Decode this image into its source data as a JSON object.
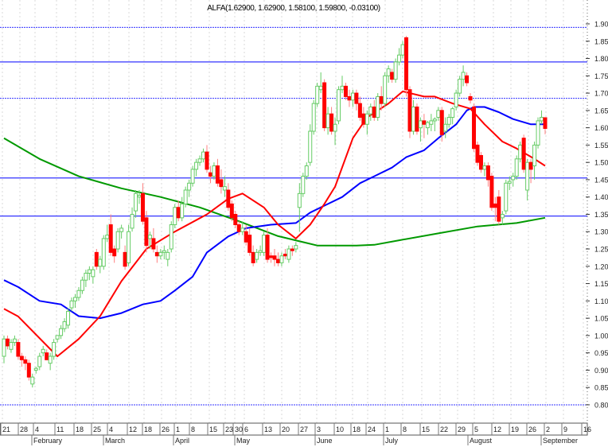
{
  "chart_data": {
    "type": "candlestick",
    "title": "ALFA(1.62900, 1.62900, 1.58100, 1.59800, -0.03100)",
    "ylim": [
      0.78,
      1.92
    ],
    "yticks": [
      "0.80",
      "0.85",
      "0.90",
      "0.95",
      "1.00",
      "1.05",
      "1.10",
      "1.15",
      "1.20",
      "1.25",
      "1.30",
      "1.35",
      "1.40",
      "1.45",
      "1.50",
      "1.55",
      "1.60",
      "1.65",
      "1.70",
      "1.75",
      "1.80",
      "1.85",
      "1.90"
    ],
    "xtick_labels": [
      "21",
      "28",
      "4",
      "11",
      "18",
      "25",
      "4",
      "12",
      "18",
      "26",
      "1",
      "8",
      "15",
      "23",
      "30",
      "6",
      "13",
      "20",
      "27",
      "3",
      "10",
      "18",
      "24",
      "1",
      "8",
      "15",
      "22",
      "29",
      "5",
      "12",
      "19",
      "26",
      "2",
      "9",
      "16"
    ],
    "months": [
      "February",
      "March",
      "April",
      "May",
      "June",
      "July",
      "August",
      "September"
    ],
    "grid": true,
    "colors": {
      "up": "#66cc66",
      "up_filled": "#009900",
      "down": "#ff0000",
      "level": "#3333ff",
      "ma_fast": "#ff0000",
      "ma_mid": "#0000ff",
      "ma_slow": "#009900"
    },
    "levels": [
      {
        "value": 1.89,
        "style": "dotted"
      },
      {
        "value": 1.79,
        "style": "solid"
      },
      {
        "value": 1.685,
        "style": "dotted"
      },
      {
        "value": 1.455,
        "style": "solid"
      },
      {
        "value": 1.345,
        "style": "solid"
      },
      {
        "value": 0.8,
        "style": "dotted"
      }
    ],
    "ohlc": [
      [
        0.94,
        1.0,
        0.92,
        0.99
      ],
      [
        0.99,
        1.0,
        0.96,
        0.97
      ],
      [
        0.96,
        0.99,
        0.95,
        0.98
      ],
      [
        0.98,
        1.0,
        0.97,
        0.99
      ],
      [
        0.98,
        0.99,
        0.93,
        0.94
      ],
      [
        0.94,
        0.95,
        0.91,
        0.93
      ],
      [
        0.93,
        0.94,
        0.9,
        0.92
      ],
      [
        0.92,
        0.93,
        0.87,
        0.88
      ],
      [
        0.86,
        0.89,
        0.85,
        0.88
      ],
      [
        0.9,
        0.91,
        0.89,
        0.905
      ],
      [
        0.91,
        0.95,
        0.9,
        0.94
      ],
      [
        0.95,
        0.97,
        0.94,
        0.96
      ],
      [
        0.95,
        0.96,
        0.93,
        0.93
      ],
      [
        0.92,
        0.95,
        0.9,
        0.94
      ],
      [
        0.94,
        0.99,
        0.93,
        0.98
      ],
      [
        0.99,
        1.0,
        0.98,
        1.0
      ],
      [
        1.0,
        1.03,
        0.99,
        1.02
      ],
      [
        1.02,
        1.05,
        1.01,
        1.04
      ],
      [
        1.03,
        1.08,
        1.02,
        1.07
      ],
      [
        1.08,
        1.11,
        1.07,
        1.1
      ],
      [
        1.1,
        1.12,
        1.08,
        1.11
      ],
      [
        1.11,
        1.14,
        1.1,
        1.13
      ],
      [
        1.13,
        1.17,
        1.12,
        1.16
      ],
      [
        1.16,
        1.19,
        1.14,
        1.18
      ],
      [
        1.18,
        1.2,
        1.16,
        1.19
      ],
      [
        1.17,
        1.2,
        1.15,
        1.19
      ],
      [
        1.24,
        1.25,
        1.19,
        1.2
      ],
      [
        1.2,
        1.23,
        1.18,
        1.22
      ],
      [
        1.2,
        1.29,
        1.19,
        1.28
      ],
      [
        1.28,
        1.32,
        1.27,
        1.29
      ],
      [
        1.32,
        1.35,
        1.23,
        1.24
      ],
      [
        1.25,
        1.26,
        1.21,
        1.23
      ],
      [
        1.25,
        1.31,
        1.24,
        1.3
      ],
      [
        1.3,
        1.32,
        1.28,
        1.31
      ],
      [
        1.24,
        1.26,
        1.19,
        1.2
      ],
      [
        1.21,
        1.32,
        1.2,
        1.3
      ],
      [
        1.31,
        1.37,
        1.3,
        1.35
      ],
      [
        1.36,
        1.42,
        1.34,
        1.41
      ],
      [
        1.4,
        1.42,
        1.38,
        1.405
      ],
      [
        1.41,
        1.44,
        1.32,
        1.33
      ],
      [
        1.34,
        1.36,
        1.24,
        1.26
      ],
      [
        1.28,
        1.3,
        1.25,
        1.29
      ],
      [
        1.28,
        1.31,
        1.24,
        1.25
      ],
      [
        1.24,
        1.26,
        1.21,
        1.23
      ],
      [
        1.23,
        1.25,
        1.22,
        1.24
      ],
      [
        1.24,
        1.26,
        1.22,
        1.245
      ],
      [
        1.22,
        1.25,
        1.2,
        1.24
      ],
      [
        1.25,
        1.33,
        1.24,
        1.32
      ],
      [
        1.32,
        1.38,
        1.31,
        1.37
      ],
      [
        1.37,
        1.39,
        1.33,
        1.34
      ],
      [
        1.34,
        1.4,
        1.33,
        1.38
      ],
      [
        1.38,
        1.43,
        1.37,
        1.42
      ],
      [
        1.42,
        1.45,
        1.4,
        1.44
      ],
      [
        1.44,
        1.49,
        1.43,
        1.48
      ],
      [
        1.48,
        1.51,
        1.46,
        1.5
      ],
      [
        1.5,
        1.52,
        1.49,
        1.51
      ],
      [
        1.51,
        1.54,
        1.5,
        1.53
      ],
      [
        1.53,
        1.55,
        1.47,
        1.48
      ],
      [
        1.47,
        1.49,
        1.44,
        1.46
      ],
      [
        1.46,
        1.5,
        1.45,
        1.49
      ],
      [
        1.49,
        1.51,
        1.43,
        1.44
      ],
      [
        1.45,
        1.48,
        1.41,
        1.43
      ],
      [
        1.42,
        1.46,
        1.4,
        1.43
      ],
      [
        1.42,
        1.44,
        1.36,
        1.37
      ],
      [
        1.38,
        1.39,
        1.33,
        1.34
      ],
      [
        1.35,
        1.36,
        1.31,
        1.32
      ],
      [
        1.32,
        1.33,
        1.29,
        1.3
      ],
      [
        1.3,
        1.33,
        1.29,
        1.31
      ],
      [
        1.3,
        1.32,
        1.26,
        1.27
      ],
      [
        1.29,
        1.31,
        1.23,
        1.24
      ],
      [
        1.24,
        1.26,
        1.2,
        1.21
      ],
      [
        1.22,
        1.25,
        1.21,
        1.24
      ],
      [
        1.24,
        1.26,
        1.23,
        1.245
      ],
      [
        1.24,
        1.3,
        1.23,
        1.29
      ],
      [
        1.29,
        1.31,
        1.21,
        1.22
      ],
      [
        1.23,
        1.24,
        1.21,
        1.225
      ],
      [
        1.23,
        1.25,
        1.2,
        1.22
      ],
      [
        1.22,
        1.24,
        1.2,
        1.21
      ],
      [
        1.21,
        1.24,
        1.2,
        1.23
      ],
      [
        1.235,
        1.25,
        1.22,
        1.23
      ],
      [
        1.22,
        1.26,
        1.21,
        1.25
      ],
      [
        1.25,
        1.26,
        1.23,
        1.245
      ],
      [
        1.25,
        1.27,
        1.24,
        1.26
      ],
      [
        1.37,
        1.44,
        1.3,
        1.41
      ],
      [
        1.41,
        1.47,
        1.4,
        1.46
      ],
      [
        1.46,
        1.5,
        1.45,
        1.49
      ],
      [
        1.5,
        1.61,
        1.49,
        1.59
      ],
      [
        1.59,
        1.68,
        1.58,
        1.67
      ],
      [
        1.67,
        1.73,
        1.66,
        1.72
      ],
      [
        1.71,
        1.76,
        1.7,
        1.72
      ],
      [
        1.73,
        1.74,
        1.59,
        1.6
      ],
      [
        1.6,
        1.66,
        1.58,
        1.64
      ],
      [
        1.64,
        1.66,
        1.58,
        1.59
      ],
      [
        1.59,
        1.63,
        1.55,
        1.61
      ],
      [
        1.62,
        1.72,
        1.61,
        1.71
      ],
      [
        1.71,
        1.75,
        1.7,
        1.72
      ],
      [
        1.72,
        1.73,
        1.68,
        1.69
      ],
      [
        1.69,
        1.71,
        1.66,
        1.68
      ],
      [
        1.68,
        1.71,
        1.66,
        1.7
      ],
      [
        1.7,
        1.71,
        1.65,
        1.67
      ],
      [
        1.67,
        1.69,
        1.62,
        1.63
      ],
      [
        1.64,
        1.66,
        1.6,
        1.61
      ],
      [
        1.61,
        1.65,
        1.58,
        1.64
      ],
      [
        1.64,
        1.67,
        1.62,
        1.66
      ],
      [
        1.66,
        1.68,
        1.62,
        1.63
      ],
      [
        1.63,
        1.7,
        1.62,
        1.69
      ],
      [
        1.69,
        1.72,
        1.65,
        1.67
      ],
      [
        1.67,
        1.76,
        1.66,
        1.75
      ],
      [
        1.75,
        1.78,
        1.73,
        1.77
      ],
      [
        1.76,
        1.77,
        1.73,
        1.74
      ],
      [
        1.74,
        1.8,
        1.73,
        1.79
      ],
      [
        1.79,
        1.83,
        1.78,
        1.81
      ],
      [
        1.81,
        1.85,
        1.8,
        1.84
      ],
      [
        1.86,
        1.865,
        1.69,
        1.71
      ],
      [
        1.71,
        1.72,
        1.57,
        1.59
      ],
      [
        1.59,
        1.68,
        1.58,
        1.66
      ],
      [
        1.66,
        1.67,
        1.58,
        1.59
      ],
      [
        1.6,
        1.63,
        1.56,
        1.62
      ],
      [
        1.62,
        1.64,
        1.57,
        1.61
      ],
      [
        1.6,
        1.62,
        1.58,
        1.615
      ],
      [
        1.61,
        1.64,
        1.59,
        1.62
      ],
      [
        1.62,
        1.63,
        1.59,
        1.625
      ],
      [
        1.63,
        1.66,
        1.62,
        1.65
      ],
      [
        1.65,
        1.66,
        1.56,
        1.58
      ],
      [
        1.59,
        1.63,
        1.57,
        1.61
      ],
      [
        1.61,
        1.64,
        1.6,
        1.63
      ],
      [
        1.63,
        1.66,
        1.61,
        1.655
      ],
      [
        1.66,
        1.71,
        1.65,
        1.7
      ],
      [
        1.7,
        1.75,
        1.69,
        1.74
      ],
      [
        1.74,
        1.78,
        1.72,
        1.76
      ],
      [
        1.75,
        1.76,
        1.72,
        1.73
      ],
      [
        1.69,
        1.7,
        1.67,
        1.68
      ],
      [
        1.66,
        1.67,
        1.53,
        1.54
      ],
      [
        1.55,
        1.56,
        1.49,
        1.5
      ],
      [
        1.52,
        1.53,
        1.47,
        1.48
      ],
      [
        1.48,
        1.5,
        1.46,
        1.49
      ],
      [
        1.49,
        1.5,
        1.43,
        1.45
      ],
      [
        1.46,
        1.47,
        1.36,
        1.37
      ],
      [
        1.38,
        1.4,
        1.33,
        1.37
      ],
      [
        1.4,
        1.42,
        1.32,
        1.33
      ],
      [
        1.34,
        1.36,
        1.32,
        1.35
      ],
      [
        1.36,
        1.45,
        1.35,
        1.44
      ],
      [
        1.44,
        1.46,
        1.42,
        1.445
      ],
      [
        1.45,
        1.47,
        1.43,
        1.46
      ],
      [
        1.46,
        1.52,
        1.45,
        1.51
      ],
      [
        1.51,
        1.56,
        1.5,
        1.55
      ],
      [
        1.57,
        1.58,
        1.47,
        1.48
      ],
      [
        1.42,
        1.51,
        1.39,
        1.5
      ],
      [
        1.5,
        1.51,
        1.44,
        1.48
      ],
      [
        1.49,
        1.56,
        1.45,
        1.55
      ],
      [
        1.55,
        1.63,
        1.54,
        1.62
      ],
      [
        1.62,
        1.65,
        1.61,
        1.63
      ],
      [
        1.629,
        1.629,
        1.581,
        1.598
      ]
    ],
    "ma_fast": [
      [
        0,
        1.077
      ],
      [
        4,
        1.055
      ],
      [
        15,
        0.94
      ],
      [
        21,
        0.99
      ],
      [
        27,
        1.056
      ],
      [
        33,
        1.157
      ],
      [
        40,
        1.25
      ],
      [
        48,
        1.3
      ],
      [
        57,
        1.35
      ],
      [
        63,
        1.395
      ],
      [
        67,
        1.41
      ],
      [
        73,
        1.37
      ],
      [
        77,
        1.32
      ],
      [
        82,
        1.28
      ],
      [
        86,
        1.32
      ],
      [
        90,
        1.38
      ],
      [
        93,
        1.43
      ],
      [
        98,
        1.57
      ],
      [
        102,
        1.63
      ],
      [
        108,
        1.67
      ],
      [
        112,
        1.705
      ],
      [
        118,
        1.69
      ],
      [
        121,
        1.69
      ],
      [
        126,
        1.67
      ],
      [
        131,
        1.655
      ],
      [
        135,
        1.61
      ],
      [
        140,
        1.56
      ],
      [
        144,
        1.54
      ],
      [
        149,
        1.51
      ],
      [
        152,
        1.49
      ]
    ],
    "ma_mid": [
      [
        0,
        1.16
      ],
      [
        4,
        1.14
      ],
      [
        10,
        1.1
      ],
      [
        16,
        1.09
      ],
      [
        21,
        1.056
      ],
      [
        27,
        1.05
      ],
      [
        33,
        1.065
      ],
      [
        39,
        1.09
      ],
      [
        44,
        1.1
      ],
      [
        48,
        1.13
      ],
      [
        53,
        1.17
      ],
      [
        57,
        1.24
      ],
      [
        63,
        1.286
      ],
      [
        68,
        1.31
      ],
      [
        75,
        1.32
      ],
      [
        82,
        1.325
      ],
      [
        86,
        1.355
      ],
      [
        91,
        1.38
      ],
      [
        95,
        1.4
      ],
      [
        100,
        1.44
      ],
      [
        104,
        1.46
      ],
      [
        109,
        1.485
      ],
      [
        113,
        1.515
      ],
      [
        118,
        1.535
      ],
      [
        122,
        1.57
      ],
      [
        127,
        1.61
      ],
      [
        130,
        1.65
      ],
      [
        132,
        1.66
      ],
      [
        135,
        1.66
      ],
      [
        139,
        1.645
      ],
      [
        143,
        1.625
      ],
      [
        148,
        1.61
      ],
      [
        152,
        1.61
      ]
    ],
    "ma_slow": [
      [
        0,
        1.57
      ],
      [
        10,
        1.51
      ],
      [
        21,
        1.46
      ],
      [
        33,
        1.425
      ],
      [
        44,
        1.4
      ],
      [
        55,
        1.37
      ],
      [
        66,
        1.33
      ],
      [
        77,
        1.287
      ],
      [
        88,
        1.26
      ],
      [
        99,
        1.26
      ],
      [
        104,
        1.262
      ],
      [
        111,
        1.275
      ],
      [
        122,
        1.295
      ],
      [
        133,
        1.315
      ],
      [
        144,
        1.325
      ],
      [
        152,
        1.34
      ]
    ]
  }
}
